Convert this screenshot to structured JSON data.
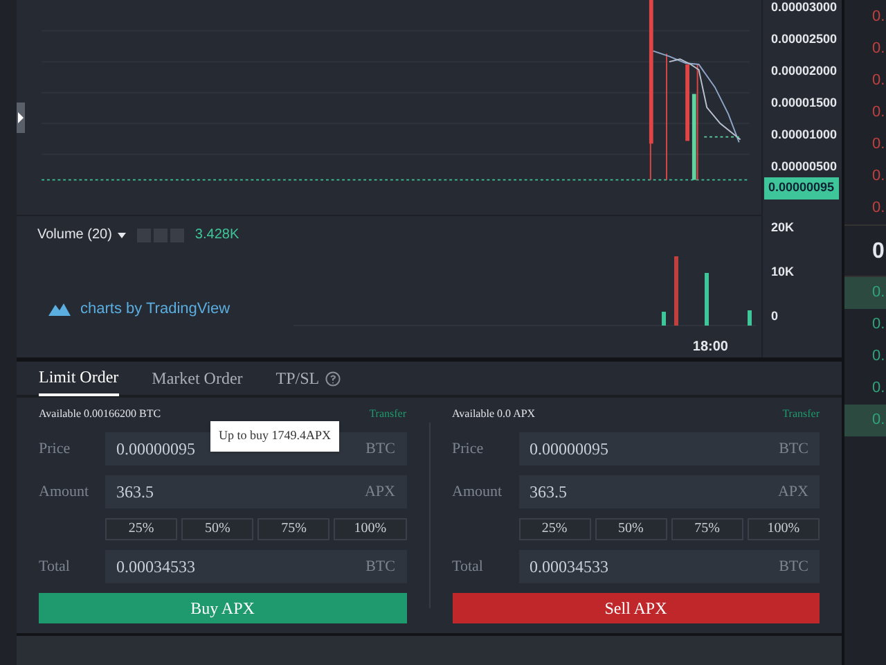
{
  "chart": {
    "price_labels": [
      "0.00003000",
      "0.00002500",
      "0.00002000",
      "0.00001500",
      "0.00001000",
      "0.00000500"
    ],
    "last_price": "0.00000095",
    "volume": {
      "label": "Volume (20)",
      "value": "3.428K",
      "axis_labels": [
        "20K",
        "10K",
        "0"
      ]
    },
    "attribution": "charts by TradingView",
    "time_label": "18:00"
  },
  "order_book_edge": [
    {
      "text": "0.",
      "kind": "sell",
      "highlighted": false
    },
    {
      "text": "0.",
      "kind": "sell",
      "highlighted": false
    },
    {
      "text": "0.",
      "kind": "sell",
      "highlighted": false
    },
    {
      "text": "0.",
      "kind": "sell",
      "highlighted": false
    },
    {
      "text": "0.",
      "kind": "sell",
      "highlighted": false
    },
    {
      "text": "0.",
      "kind": "sell",
      "highlighted": false
    },
    {
      "text": "0.",
      "kind": "sell",
      "highlighted": false
    },
    {
      "text": "0",
      "kind": "last",
      "highlighted": false
    },
    {
      "text": "0.",
      "kind": "buy",
      "highlighted": true
    },
    {
      "text": "0.",
      "kind": "buy",
      "highlighted": false
    },
    {
      "text": "0.",
      "kind": "buy",
      "highlighted": false
    },
    {
      "text": "0.",
      "kind": "buy",
      "highlighted": false
    },
    {
      "text": "0.",
      "kind": "buy",
      "highlighted": true
    }
  ],
  "tabs": [
    {
      "label": "Limit Order",
      "selected": true
    },
    {
      "label": "Market Order",
      "selected": false
    },
    {
      "label": "TP/SL",
      "selected": false
    }
  ],
  "order_panels": [
    {
      "kind": "buy",
      "available": "Available 0.00166200 BTC",
      "transfer": "Transfer",
      "tooltip": "Up to buy 1749.4APX",
      "fields": [
        {
          "label": "Price",
          "value": "0.00000095",
          "unit": "BTC"
        },
        {
          "label": "Amount",
          "value": "363.5",
          "unit": "APX"
        }
      ],
      "percents": [
        "25%",
        "50%",
        "75%",
        "100%"
      ],
      "total": {
        "label": "Total",
        "value": "0.00034533",
        "unit": "BTC"
      },
      "button": "Buy APX"
    },
    {
      "kind": "sell",
      "available": "Available 0.0 APX",
      "transfer": "Transfer",
      "fields": [
        {
          "label": "Price",
          "value": "0.00000095",
          "unit": "BTC"
        },
        {
          "label": "Amount",
          "value": "363.5",
          "unit": "APX"
        }
      ],
      "percents": [
        "25%",
        "50%",
        "75%",
        "100%"
      ],
      "total": {
        "label": "Total",
        "value": "0.00034533",
        "unit": "BTC"
      },
      "button": "Sell APX"
    }
  ]
}
